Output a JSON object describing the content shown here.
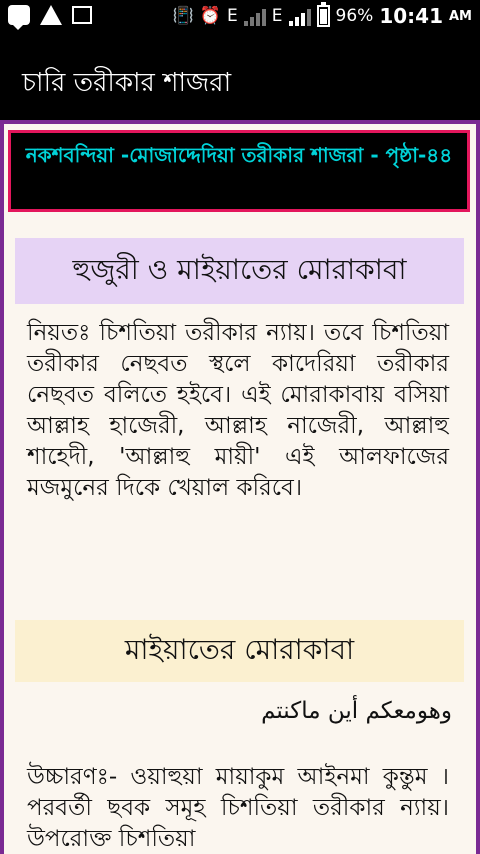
{
  "status_bar": {
    "network_e1": "E",
    "network_e2": "E",
    "battery": "96%",
    "time": "10:41",
    "ampm": "AM"
  },
  "app_bar": {
    "title": "চারি তরীকার শাজরা"
  },
  "header_box": {
    "text": "নকশবন্দিয়া -মোজাদ্দেদিয়া তরীকার শাজরা  - পৃষ্ঠা-৪৪"
  },
  "section1": {
    "heading": "হুজুরী ও মাইয়াতের মোরাকাবা",
    "paragraph": "নিয়তঃ চিশতিয়া তরীকার ন্যায়। তবে চিশতিয়া তরীকার নেছবত স্থলে কাদেরিয়া তরীকার নেছবত বলিতে হইবে। এই মোরাকাবায় বসিয়া আল্লাহ হাজেরী, আল্লাহ নাজেরী, আল্লাহু শাহেদী, 'আল্লাহু মায়ী' এই আলফাজের মজমুনের দিকে খেয়াল করিবে।"
  },
  "section2": {
    "heading": "মাইয়াতের মোরাকাবা",
    "arabic": "وهومعكم أين ماكنتم",
    "paragraph": "উচ্চারণঃ- ওয়াহুয়া মায়াকুম আইনমা কুন্তুম । পরবর্তী ছবক সমূহ চিশতিয়া তরীকার ন্যায়। উপরোক্ত চিশতিয়া"
  }
}
